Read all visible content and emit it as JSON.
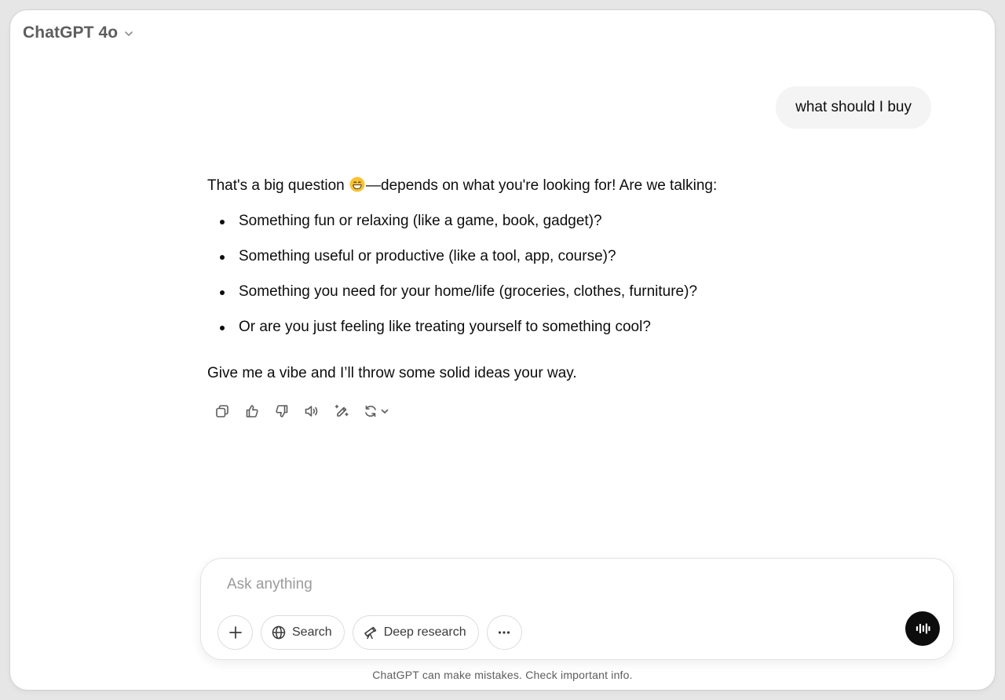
{
  "header": {
    "model_name": "ChatGPT 4o"
  },
  "conversation": {
    "user_message": "what should I buy",
    "assistant": {
      "intro_before_emoji": "That's a big question ",
      "intro_after_emoji": "—depends on what you're looking for! Are we talking:",
      "emoji": "grinning-face-smiling-eyes",
      "bullets": [
        "Something fun or relaxing (like a game, book, gadget)?",
        "Something useful or productive (like a tool, app, course)?",
        "Something you need for your home/life (groceries, clothes, furniture)?",
        "Or are you just feeling like treating yourself to something cool?"
      ],
      "outro": "Give me a vibe and I’ll throw some solid ideas your way."
    },
    "actions": [
      "copy-icon",
      "thumbs-up-icon",
      "thumbs-down-icon",
      "read-aloud-icon",
      "edit-in-canvas-icon",
      "regenerate-icon"
    ]
  },
  "composer": {
    "placeholder": "Ask anything",
    "value": "",
    "tools": {
      "search_label": "Search",
      "deep_research_label": "Deep research"
    }
  },
  "footer": {
    "disclaimer": "ChatGPT can make mistakes. Check important info."
  },
  "colors": {
    "accent_dark": "#0d0d0d",
    "bubble_bg": "#f4f4f4",
    "muted_text": "#5d5d5d"
  }
}
